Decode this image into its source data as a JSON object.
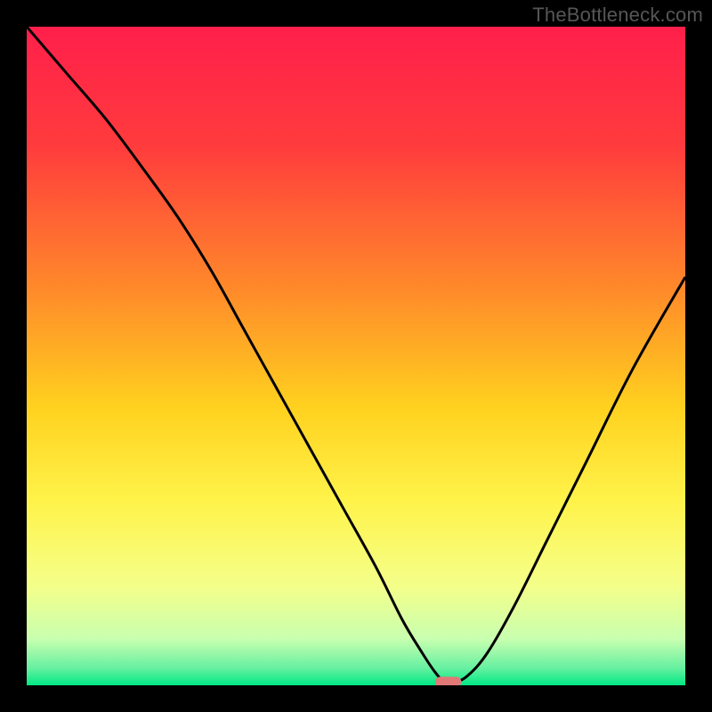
{
  "watermark": "TheBottleneck.com",
  "chart_data": {
    "type": "line",
    "title": "",
    "xlabel": "",
    "ylabel": "",
    "xlim": [
      0,
      100
    ],
    "ylim": [
      0,
      100
    ],
    "gradient_stops": [
      {
        "offset": 0.0,
        "color": "#ff1f4b"
      },
      {
        "offset": 0.18,
        "color": "#ff3b3d"
      },
      {
        "offset": 0.4,
        "color": "#ff8a2a"
      },
      {
        "offset": 0.58,
        "color": "#ffd21f"
      },
      {
        "offset": 0.72,
        "color": "#fff34a"
      },
      {
        "offset": 0.85,
        "color": "#f4ff8a"
      },
      {
        "offset": 0.93,
        "color": "#c8ffb0"
      },
      {
        "offset": 0.975,
        "color": "#63f0a0"
      },
      {
        "offset": 1.0,
        "color": "#00e884"
      }
    ],
    "series": [
      {
        "name": "bottleneck-curve",
        "x": [
          0,
          6,
          12,
          18,
          23,
          28,
          33,
          38,
          43,
          48,
          53,
          57,
          60,
          62,
          63.5,
          65,
          67,
          70,
          74,
          79,
          85,
          92,
          100
        ],
        "y": [
          100,
          93,
          86,
          78,
          71,
          63,
          54,
          45,
          36,
          27,
          18,
          10,
          5,
          2,
          0.5,
          0.5,
          1.5,
          5,
          12,
          22,
          34,
          48,
          62
        ]
      }
    ],
    "marker": {
      "name": "optimal-point",
      "x": 64,
      "y": 0.5,
      "color": "#e07878",
      "width": 4.0,
      "height": 1.6
    }
  }
}
